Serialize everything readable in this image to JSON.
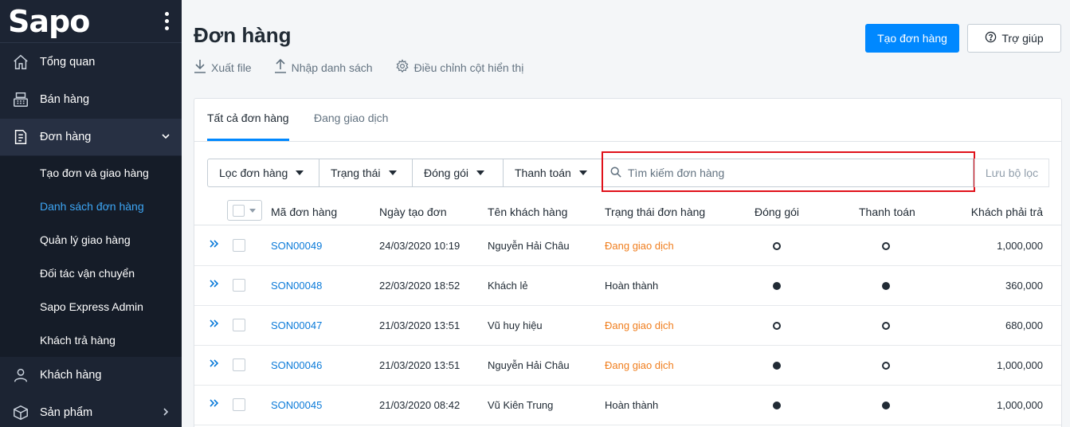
{
  "logo_text": "Sapo",
  "sidebar": {
    "items": [
      {
        "label": "Tổng quan",
        "icon": "home-icon"
      },
      {
        "label": "Bán hàng",
        "icon": "cash-register-icon"
      },
      {
        "label": "Đơn hàng",
        "icon": "order-document-icon"
      },
      {
        "label": "Khách hàng",
        "icon": "user-icon"
      },
      {
        "label": "Sản phẩm",
        "icon": "box-icon"
      }
    ],
    "subitems": [
      {
        "label": "Tạo đơn và giao hàng"
      },
      {
        "label": "Danh sách đơn hàng"
      },
      {
        "label": "Quản lý giao hàng"
      },
      {
        "label": "Đối tác vận chuyển"
      },
      {
        "label": "Sapo Express Admin"
      },
      {
        "label": "Khách trả hàng"
      }
    ]
  },
  "page": {
    "title": "Đơn hàng",
    "actions": [
      "Xuất file",
      "Nhập danh sách",
      "Điều chỉnh cột hiển thị"
    ],
    "create_button": "Tạo đơn hàng",
    "help_button": "Trợ giúp"
  },
  "tabs": [
    "Tất cả đơn hàng",
    "Đang giao dịch"
  ],
  "filters": {
    "buttons": [
      "Lọc đơn hàng",
      "Trạng thái",
      "Đóng gói",
      "Thanh toán"
    ],
    "search_placeholder": "Tìm kiếm đơn hàng",
    "save_label": "Lưu bộ lọc"
  },
  "table": {
    "columns": [
      "Mã đơn hàng",
      "Ngày tạo đơn",
      "Tên khách hàng",
      "Trạng thái đơn hàng",
      "Đóng gói",
      "Thanh toán",
      "Khách phải trả"
    ],
    "rows": [
      {
        "code": "SON00049",
        "date": "24/03/2020 10:19",
        "customer": "Nguyễn Hải Châu",
        "status": "Đang giao dịch",
        "packed": false,
        "paid": false,
        "amount": "1,000,000"
      },
      {
        "code": "SON00048",
        "date": "22/03/2020 18:52",
        "customer": "Khách lẻ",
        "status": "Hoàn thành",
        "packed": true,
        "paid": true,
        "amount": "360,000"
      },
      {
        "code": "SON00047",
        "date": "21/03/2020 13:51",
        "customer": "Vũ huy hiệu",
        "status": "Đang giao dịch",
        "packed": false,
        "paid": false,
        "amount": "680,000"
      },
      {
        "code": "SON00046",
        "date": "21/03/2020 13:51",
        "customer": "Nguyễn Hải Châu",
        "status": "Đang giao dịch",
        "packed": true,
        "paid": false,
        "amount": "1,000,000"
      },
      {
        "code": "SON00045",
        "date": "21/03/2020 08:42",
        "customer": "Vũ Kiên Trung",
        "status": "Hoàn thành",
        "packed": true,
        "paid": true,
        "amount": "1,000,000"
      }
    ]
  },
  "colors": {
    "sidebar_bg": "#1c2433",
    "primary": "#0088ff",
    "link": "#0a7ad9",
    "pending": "#f07e1e",
    "highlight": "#e0111a"
  }
}
